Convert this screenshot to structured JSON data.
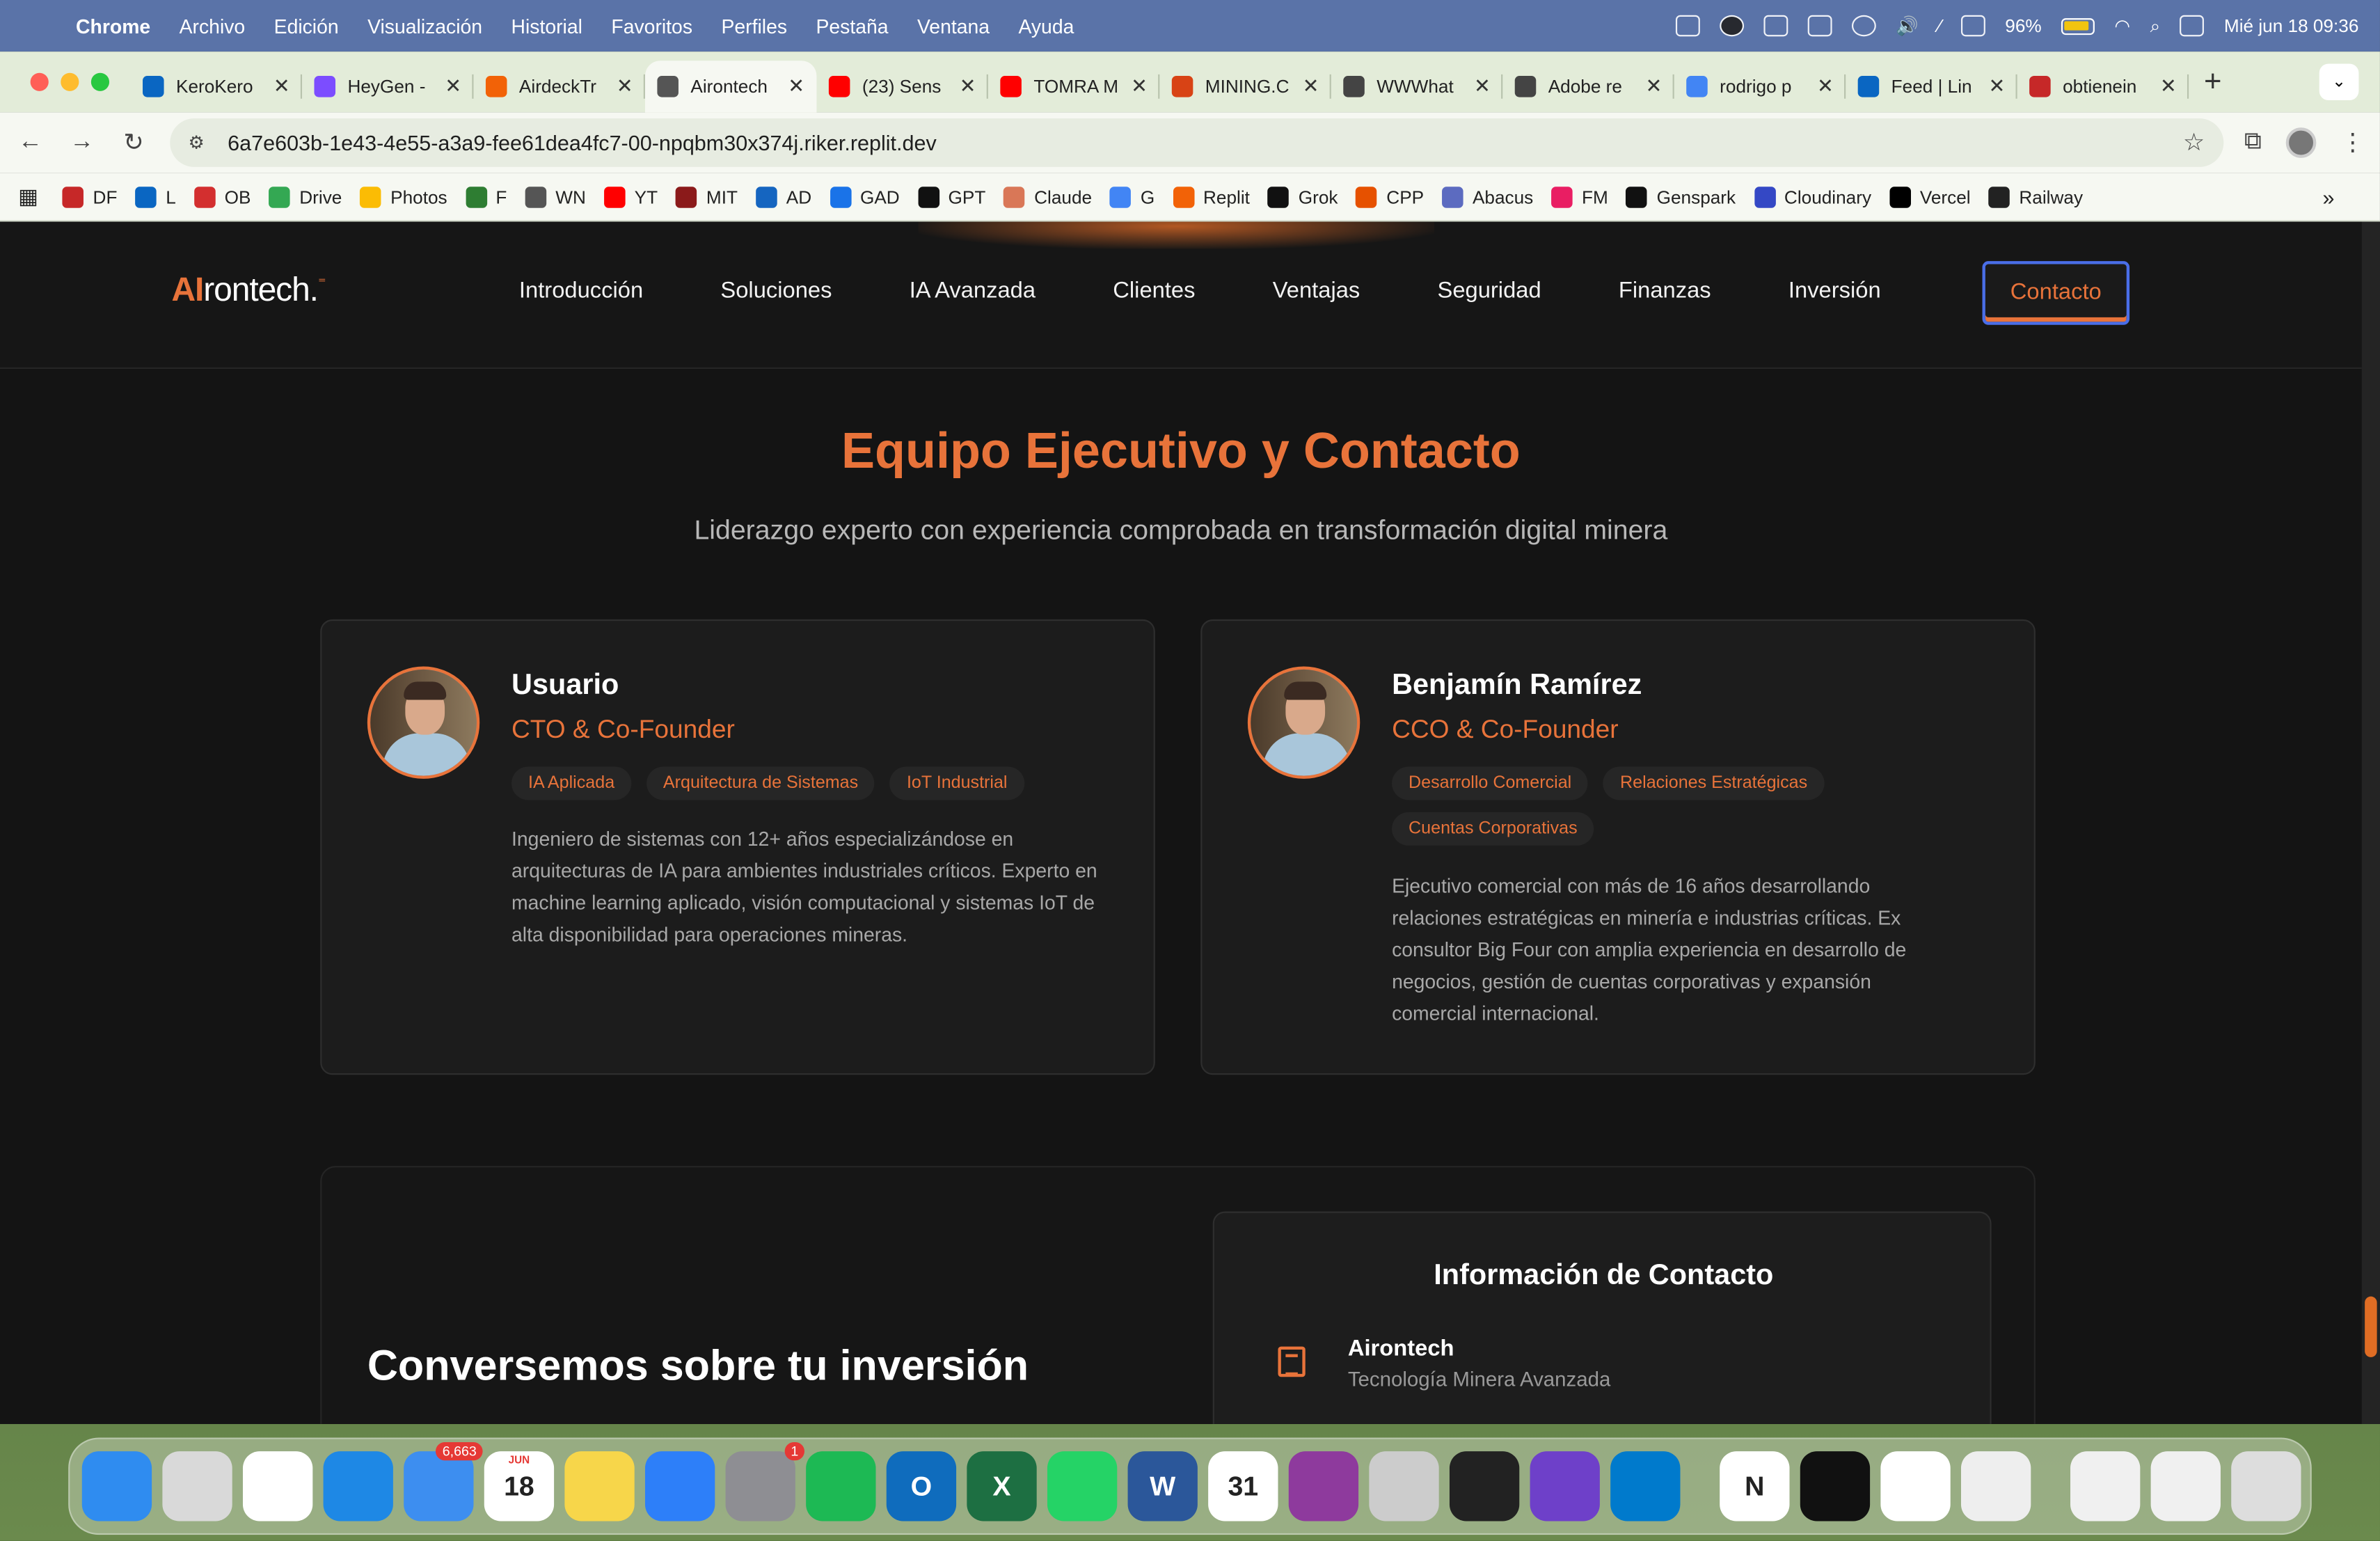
{
  "menubar": {
    "app": "Chrome",
    "menus": [
      "Archivo",
      "Edición",
      "Visualización",
      "Historial",
      "Favoritos",
      "Perfiles",
      "Pestaña",
      "Ventana",
      "Ayuda"
    ],
    "battery": "96%",
    "datetime": "Mié jun 18  09:36"
  },
  "tabs": [
    {
      "title": "KeroKero",
      "color": "#0a66c2"
    },
    {
      "title": "HeyGen -",
      "color": "#7c4dff"
    },
    {
      "title": "AirdeckTr",
      "color": "#f26207"
    },
    {
      "title": "Airontech",
      "color": "#555555",
      "active": true
    },
    {
      "title": "(23) Sens",
      "color": "#ff0000"
    },
    {
      "title": "TOMRA M",
      "color": "#ff0000"
    },
    {
      "title": "MINING.C",
      "color": "#d84315"
    },
    {
      "title": "WWWhat",
      "color": "#444444"
    },
    {
      "title": "Adobe re",
      "color": "#444444"
    },
    {
      "title": "rodrigo p",
      "color": "#4285f4"
    },
    {
      "title": "Feed | Lin",
      "color": "#0a66c2"
    },
    {
      "title": "obtienein",
      "color": "#c62828"
    }
  ],
  "omnibox": {
    "url": "6a7e603b-1e43-4e55-a3a9-fee61dea4fc7-00-npqbm30x374j.riker.replit.dev"
  },
  "bookmarks": [
    {
      "label": "DF",
      "color": "#c62828"
    },
    {
      "label": "L",
      "color": "#0a66c2"
    },
    {
      "label": "OB",
      "color": "#d32f2f"
    },
    {
      "label": "Drive",
      "color": "#34a853"
    },
    {
      "label": "Photos",
      "color": "#fbbc04"
    },
    {
      "label": "F",
      "color": "#2e7d32"
    },
    {
      "label": "WN",
      "color": "#555555"
    },
    {
      "label": "YT",
      "color": "#ff0000"
    },
    {
      "label": "MIT",
      "color": "#8b1a1a"
    },
    {
      "label": "AD",
      "color": "#1565c0"
    },
    {
      "label": "GAD",
      "color": "#1a73e8"
    },
    {
      "label": "GPT",
      "color": "#111111"
    },
    {
      "label": "Claude",
      "color": "#d97757"
    },
    {
      "label": "G",
      "color": "#4285f4"
    },
    {
      "label": "Replit",
      "color": "#f26207"
    },
    {
      "label": "Grok",
      "color": "#111111"
    },
    {
      "label": "CPP",
      "color": "#e65100"
    },
    {
      "label": "Abacus",
      "color": "#5c6bc0"
    },
    {
      "label": "FM",
      "color": "#e91e63"
    },
    {
      "label": "Genspark",
      "color": "#111111"
    },
    {
      "label": "Cloudinary",
      "color": "#3448c5"
    },
    {
      "label": "Vercel",
      "color": "#000000"
    },
    {
      "label": "Railway",
      "color": "#222222"
    }
  ],
  "site": {
    "logo_ai": "AI",
    "logo_rest": "rontech.",
    "nav": [
      "Introducción",
      "Soluciones",
      "IA Avanzada",
      "Clientes",
      "Ventajas",
      "Seguridad",
      "Finanzas",
      "Inversión"
    ],
    "cta": "Contacto",
    "accent": "#e8733a",
    "section_title": "Equipo Ejecutivo y Contacto",
    "section_subtitle": "Liderazgo experto con experiencia comprobada en transformación digital minera",
    "team": [
      {
        "name": "Usuario",
        "role": "CTO & Co-Founder",
        "tags": [
          "IA Aplicada",
          "Arquitectura de Sistemas",
          "IoT Industrial"
        ],
        "description": "Ingeniero de sistemas con 12+ años especializándose en arquitecturas de IA para ambientes industriales críticos. Experto en machine learning aplicado, visión computacional y sistemas IoT de alta disponibilidad para operaciones mineras."
      },
      {
        "name": "Benjamín Ramírez",
        "role": "CCO & Co-Founder",
        "tags": [
          "Desarrollo Comercial",
          "Relaciones Estratégicas",
          "Cuentas Corporativas"
        ],
        "description": "Ejecutivo comercial con más de 16 años desarrollando relaciones estratégicas en minería e industrias críticas. Ex consultor Big Four con amplia experiencia en desarrollo de negocios, gestión de cuentas corporativas y expansión comercial internacional."
      }
    ],
    "contact": {
      "heading": "Conversemos sobre tu inversión",
      "info_title": "Información de Contacto",
      "company": "Airontech",
      "company_tagline": "Tecnología Minera Avanzada"
    }
  },
  "dock": {
    "apps": [
      {
        "name": "finder",
        "color": "#2f8cf0",
        "glyph": ""
      },
      {
        "name": "launchpad",
        "color": "#d9d9d9",
        "glyph": ""
      },
      {
        "name": "chrome",
        "color": "#ffffff",
        "glyph": ""
      },
      {
        "name": "safari",
        "color": "#1e88e5",
        "glyph": ""
      },
      {
        "name": "mail",
        "color": "#3d8ef0",
        "glyph": "",
        "badge": "6,663"
      },
      {
        "name": "calendar",
        "color": "#ffffff",
        "glyph": "18",
        "label": "JUN"
      },
      {
        "name": "notes",
        "color": "#f7d64a",
        "glyph": ""
      },
      {
        "name": "keynote",
        "color": "#2d7ff9",
        "glyph": ""
      },
      {
        "name": "system-settings",
        "color": "#8e8e93",
        "glyph": "",
        "badge": "1"
      },
      {
        "name": "spotify",
        "color": "#1db954",
        "glyph": ""
      },
      {
        "name": "outlook",
        "color": "#0f6cbd",
        "glyph": "O"
      },
      {
        "name": "excel",
        "color": "#1d6f42",
        "glyph": "X"
      },
      {
        "name": "whatsapp",
        "color": "#25d366",
        "glyph": ""
      },
      {
        "name": "word",
        "color": "#2b579a",
        "glyph": "W"
      },
      {
        "name": "calendar-31",
        "color": "#ffffff",
        "glyph": "31"
      },
      {
        "name": "circle-app",
        "color": "#8e3a9d",
        "glyph": ""
      },
      {
        "name": "phone-mirror",
        "color": "#cccccc",
        "glyph": ""
      },
      {
        "name": "arc",
        "color": "#222222",
        "glyph": ""
      },
      {
        "name": "github-desktop",
        "color": "#6e40c9",
        "glyph": ""
      },
      {
        "name": "vscode",
        "color": "#007acc",
        "glyph": ""
      },
      {
        "name": "notion",
        "color": "#ffffff",
        "glyph": "N"
      },
      {
        "name": "webex",
        "color": "#111111",
        "glyph": ""
      },
      {
        "name": "microsoft-store",
        "color": "#ffffff",
        "glyph": ""
      },
      {
        "name": "textedit",
        "color": "#eeeeee",
        "glyph": ""
      },
      {
        "name": "txt-file",
        "color": "#f0f0f0",
        "glyph": ""
      },
      {
        "name": "preview-window",
        "color": "#f0f0f0",
        "glyph": ""
      },
      {
        "name": "trash",
        "color": "#dddddd",
        "glyph": ""
      }
    ]
  }
}
